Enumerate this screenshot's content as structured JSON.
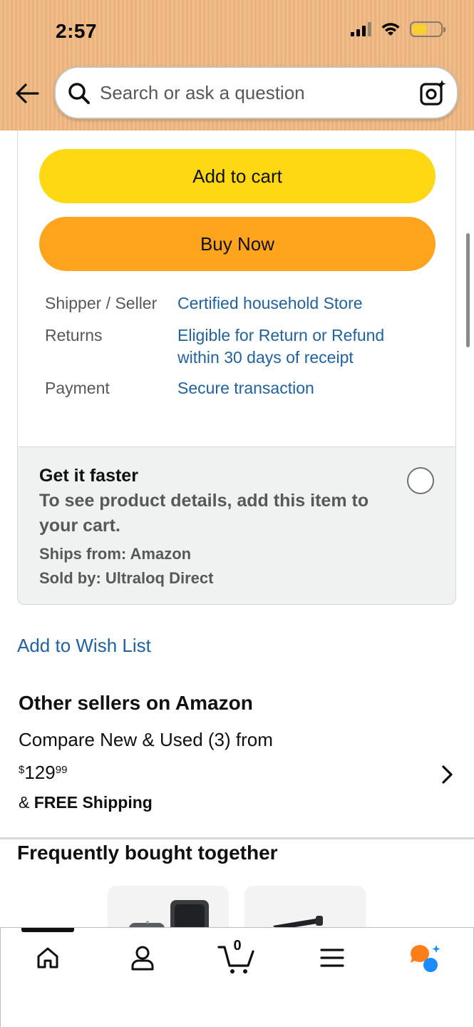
{
  "status_bar": {
    "time": "2:57"
  },
  "search": {
    "placeholder": "Search or ask a question"
  },
  "buy_box": {
    "add_to_cart_label": "Add to cart",
    "buy_now_label": "Buy Now",
    "details": [
      {
        "label": "Shipper / Seller",
        "value": "Certified household Store"
      },
      {
        "label": "Returns",
        "value": "Eligible for Return or Refund within 30 days of receipt"
      },
      {
        "label": "Payment",
        "value": "Secure transaction"
      }
    ]
  },
  "get_it_faster": {
    "title": "Get it faster",
    "description": "To see product details, add this item to your cart.",
    "ships_from": "Ships from: Amazon",
    "sold_by": "Sold by: Ultraloq Direct"
  },
  "wish_list_label": "Add to Wish List",
  "other_sellers": {
    "title": "Other sellers on Amazon",
    "compare": "Compare New & Used (3) from",
    "price_symbol": "$",
    "price_whole": "129",
    "price_fraction": "99",
    "shipping_prefix": "& ",
    "shipping_bold": "FREE Shipping"
  },
  "frequently_bought": {
    "title": "Frequently bought together"
  },
  "bottom_nav": {
    "cart_count": "0",
    "items": [
      "home-icon",
      "account-icon",
      "cart-icon",
      "menu-icon",
      "rufus-ai-icon"
    ]
  },
  "colors": {
    "add_to_cart": "#ffd814",
    "buy_now": "#ffa41c",
    "link": "#2162a1",
    "header_bg": "#f0bd8a",
    "ai_orange": "#ff7e1a",
    "ai_blue": "#1a8cff"
  }
}
